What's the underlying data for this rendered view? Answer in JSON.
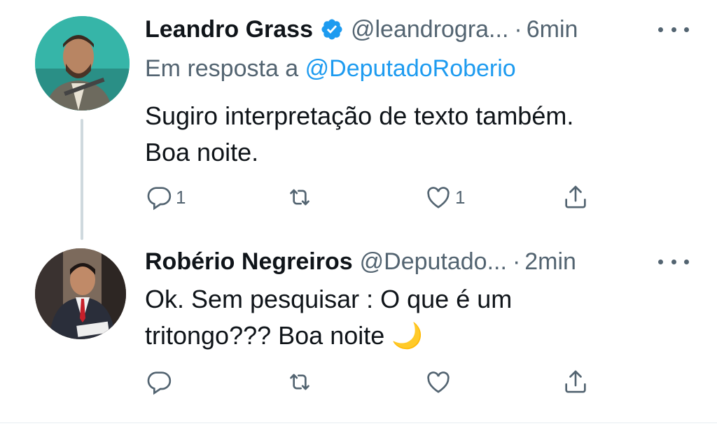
{
  "tweets": [
    {
      "author_name": "Leandro Grass",
      "verified": true,
      "handle": "@leandrogra...",
      "separator": "·",
      "time": "6min",
      "reply_prefix": "Em resposta a",
      "reply_mention": "@DeputadoRoberio",
      "text_line1": "Sugiro interpretação de texto também.",
      "text_line2": "Boa noite.",
      "reply_count": "1",
      "retweet_count": "",
      "like_count": "1"
    },
    {
      "author_name": "Robério Negreiros",
      "verified": false,
      "handle": "@Deputado...",
      "separator": "·",
      "time": "2min",
      "text_line1": "Ok. Sem pesquisar : O que é um",
      "text_line2": "tritongo??? Boa noite",
      "emoji": "🌙",
      "reply_count": "",
      "retweet_count": "",
      "like_count": ""
    }
  ],
  "colors": {
    "text": "#0f1419",
    "secondary": "#536471",
    "accent": "#1d9bf0",
    "thread_line": "#cfd9de"
  },
  "icons": [
    "verified-badge-icon",
    "more-options-icon",
    "reply-icon",
    "retweet-icon",
    "like-icon",
    "share-icon"
  ]
}
